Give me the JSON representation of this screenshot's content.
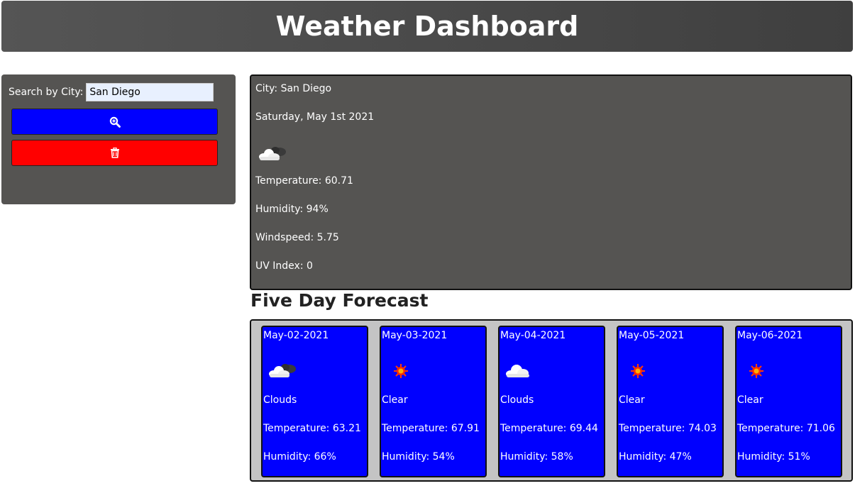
{
  "header": {
    "title": "Weather Dashboard"
  },
  "search": {
    "label": "Search by City:",
    "value": "San Diego",
    "search_button_icon": "search-plus-icon",
    "clear_button_icon": "trash-icon",
    "search_button_color": "#0000ff",
    "clear_button_color": "#ff0000"
  },
  "current": {
    "city": "City: San Diego",
    "date": "Saturday, May 1st 2021",
    "icon": "broken-clouds-icon",
    "temperature": "Temperature: 60.71",
    "humidity": "Humidity: 94%",
    "windspeed": "Windspeed: 5.75",
    "uv_index": "UV Index: 0"
  },
  "forecast": {
    "title": "Five Day Forecast",
    "days": [
      {
        "date": "May-02-2021",
        "icon": "broken-clouds-icon",
        "description": "Clouds",
        "temperature": "Temperature: 63.21",
        "humidity": "Humidity: 66%"
      },
      {
        "date": "May-03-2021",
        "icon": "sun-icon",
        "description": "Clear",
        "temperature": "Temperature: 67.91",
        "humidity": "Humidity: 54%"
      },
      {
        "date": "May-04-2021",
        "icon": "cloud-icon",
        "description": "Clouds",
        "temperature": "Temperature: 69.44",
        "humidity": "Humidity: 58%"
      },
      {
        "date": "May-05-2021",
        "icon": "sun-icon",
        "description": "Clear",
        "temperature": "Temperature: 74.03",
        "humidity": "Humidity: 47%"
      },
      {
        "date": "May-06-2021",
        "icon": "sun-icon",
        "description": "Clear",
        "temperature": "Temperature: 71.06",
        "humidity": "Humidity: 51%"
      }
    ]
  },
  "colors": {
    "panel_dark": "#555452",
    "card_blue": "#0000ff",
    "forecast_bg": "#c4c4c4"
  }
}
